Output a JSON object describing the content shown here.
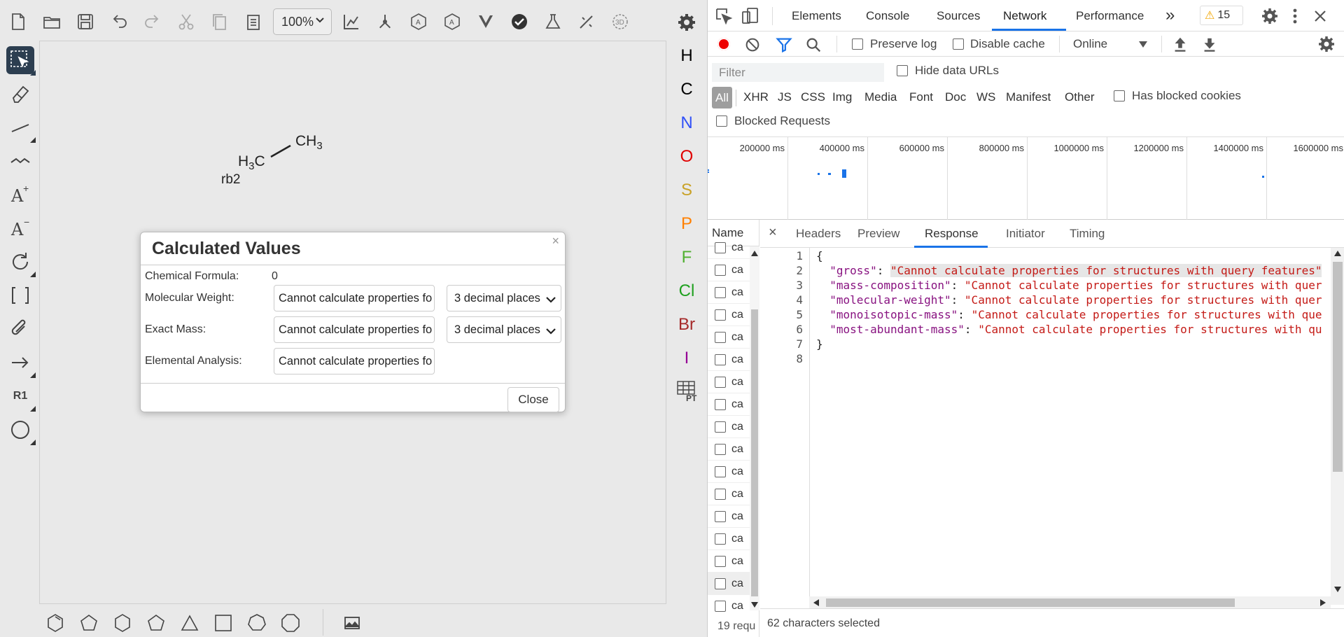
{
  "ketcher": {
    "zoom": "100%",
    "molecule": {
      "atom_ch3_top": "CH",
      "atom_h3c": "H",
      "atom_h3c_c": "C",
      "sub3": "3",
      "label": "rb2"
    },
    "elements": [
      {
        "symbol": "H",
        "color": "#000000"
      },
      {
        "symbol": "C",
        "color": "#000000"
      },
      {
        "symbol": "N",
        "color": "#3050f8"
      },
      {
        "symbol": "O",
        "color": "#e00000"
      },
      {
        "symbol": "S",
        "color": "#c9a227"
      },
      {
        "symbol": "P",
        "color": "#ff8000"
      },
      {
        "symbol": "F",
        "color": "#50b030"
      },
      {
        "symbol": "Cl",
        "color": "#1ea01e"
      },
      {
        "symbol": "Br",
        "color": "#a52a2a"
      },
      {
        "symbol": "I",
        "color": "#940094"
      }
    ],
    "periodic_table_label": "PT",
    "r1_label": "R1"
  },
  "dialog": {
    "title": "Calculated Values",
    "close_x": "×",
    "chemical_formula_label": "Chemical Formula:",
    "chemical_formula_value": "0",
    "molecular_weight_label": "Molecular Weight:",
    "molecular_weight_value": "Cannot calculate properties fo",
    "molecular_weight_decimals": "3 decimal places",
    "exact_mass_label": "Exact Mass:",
    "exact_mass_value": "Cannot calculate properties fo",
    "exact_mass_decimals": "3 decimal places",
    "elemental_analysis_label": "Elemental Analysis:",
    "elemental_analysis_value": "Cannot calculate properties fo",
    "close_button": "Close"
  },
  "devtools": {
    "tabs": [
      "Elements",
      "Console",
      "Sources",
      "Network",
      "Performance"
    ],
    "more_tabs": "»",
    "warning_count": "15",
    "toolbar": {
      "preserve_log": "Preserve log",
      "disable_cache": "Disable cache",
      "throttling": "Online"
    },
    "filter": {
      "placeholder": "Filter",
      "hide_data_urls": "Hide data URLs",
      "has_blocked_cookies": "Has blocked cookies",
      "blocked_requests": "Blocked Requests"
    },
    "types": [
      "All",
      "XHR",
      "JS",
      "CSS",
      "Img",
      "Media",
      "Font",
      "Doc",
      "WS",
      "Manifest",
      "Other"
    ],
    "timeline_ticks": [
      "200000 ms",
      "400000 ms",
      "600000 ms",
      "800000 ms",
      "1000000 ms",
      "1200000 ms",
      "1400000 ms",
      "1600000 ms"
    ],
    "name_header": "Name",
    "request_name": "ca",
    "request_count": "19 requ",
    "detail_tabs": [
      "Headers",
      "Preview",
      "Response",
      "Initiator",
      "Timing"
    ],
    "detail_close": "×",
    "response_lines": {
      "l1": "{",
      "l2_key": "\"gross\"",
      "l2_val": "\"Cannot calculate properties for structures with query features\"",
      "l3_key": "\"mass-composition\"",
      "l3_val": "\"Cannot calculate properties for structures with quer",
      "l4_key": "\"molecular-weight\"",
      "l4_val": "\"Cannot calculate properties for structures with quer",
      "l5_key": "\"monoisotopic-mass\"",
      "l5_val": "\"Cannot calculate properties for structures with que",
      "l6_key": "\"most-abundant-mass\"",
      "l6_val": "\"Cannot calculate properties for structures with qu",
      "l7": "}"
    },
    "line_numbers": [
      "1",
      "2",
      "3",
      "4",
      "5",
      "6",
      "7",
      "8"
    ],
    "status": "62 characters selected"
  }
}
